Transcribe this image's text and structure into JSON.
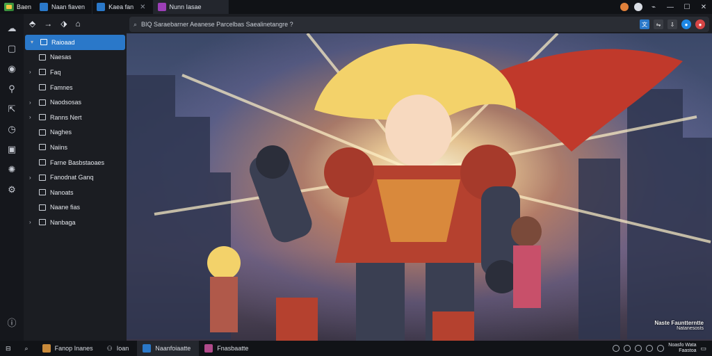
{
  "titlebar": {
    "app_label": "Baen",
    "tabs": [
      {
        "label": "Naan fiaven",
        "color": "#2a78c9"
      },
      {
        "label": "Kaea fan",
        "color": "#2a78c9"
      },
      {
        "label": "Nunn Iasae",
        "color": "#9c3fb8"
      }
    ],
    "window": {
      "minimize": "—",
      "maximize": "☐",
      "close": "✕"
    }
  },
  "address": {
    "text": "BIQ Saraebarner Aeanese Parcelbas Saealinetangre ?",
    "actions": [
      "translate",
      "extensions",
      "profile",
      "menu"
    ]
  },
  "sidebar": {
    "items": [
      {
        "label": "Raioaad",
        "expand": "▾",
        "selected": true
      },
      {
        "label": "Naesas",
        "expand": ""
      },
      {
        "label": "Faq",
        "expand": "›"
      },
      {
        "label": "Famnes",
        "expand": ""
      },
      {
        "label": "Naodsosas",
        "expand": "›"
      },
      {
        "label": "Ranns Nert",
        "expand": "›"
      },
      {
        "label": "Naghes",
        "expand": ""
      },
      {
        "label": "Naiins",
        "expand": ""
      },
      {
        "label": "Farne Basbstaoaes",
        "expand": ""
      },
      {
        "label": "Fanodnat Ganq",
        "expand": "›"
      },
      {
        "label": "Nanoats",
        "expand": ""
      },
      {
        "label": "Naane fias",
        "expand": ""
      },
      {
        "label": "Nanbaga",
        "expand": "›"
      }
    ]
  },
  "content": {
    "watermark_line1": "Naste Fauntterntte",
    "watermark_line2": "Natanesosts"
  },
  "taskbar": {
    "items": [
      {
        "label": "Fanop Inanes",
        "color": "#c98a3a"
      },
      {
        "label": "Ioan",
        "color": "#7a7f88"
      },
      {
        "label": "Naanfoiaatte",
        "color": "#2a78c9"
      },
      {
        "label": "Fnasbaatte",
        "color": "#b04a8a"
      }
    ],
    "clock_line1": "Noasfo Wata",
    "clock_line2": "Faastoa"
  }
}
